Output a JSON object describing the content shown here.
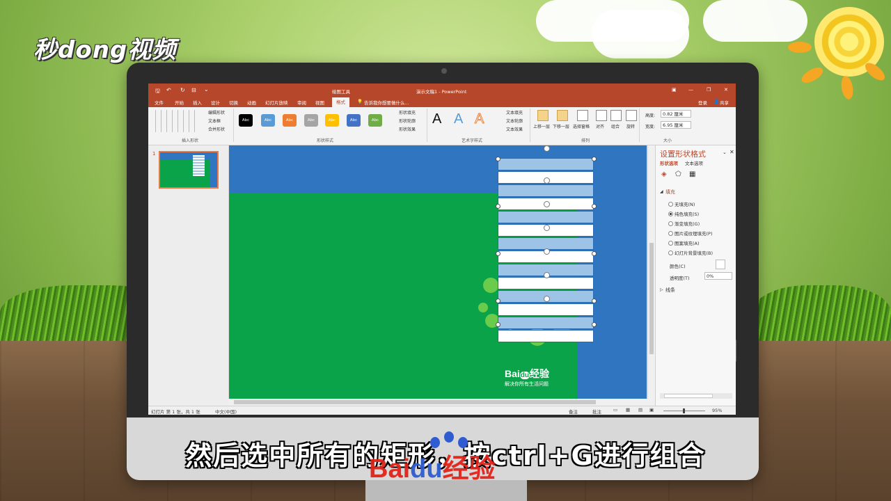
{
  "watermark": {
    "brand": "秒dong视频"
  },
  "window": {
    "drawing_tools": "绘图工具",
    "title": "演示文稿1 - PowerPoint",
    "login": "登录",
    "share": "共享",
    "controls": [
      "▣",
      "—",
      "❐",
      "✕"
    ]
  },
  "quick_access": [
    "🖫",
    "↶",
    "↻",
    "⊟",
    "⌄"
  ],
  "tabs": [
    "文件",
    "开始",
    "插入",
    "设计",
    "切换",
    "动画",
    "幻灯片放映",
    "审阅",
    "视图",
    "格式"
  ],
  "active_tab": "格式",
  "tell_me": "告诉我你想要做什么...",
  "ribbon": {
    "insert_shapes": {
      "label": "插入形状",
      "edit_shape": "编辑形状",
      "text_box": "文本框",
      "merge_shapes": "合并形状"
    },
    "shape_styles": {
      "label": "形状样式",
      "swatch_text": "Abc",
      "swatches": [
        "#000000",
        "#5b9bd5",
        "#ed7d31",
        "#a5a5a5",
        "#ffc000",
        "#4472c4",
        "#70ad47"
      ],
      "fill": "形状填充",
      "outline": "形状轮廓",
      "effects": "形状效果"
    },
    "wordart": {
      "label": "艺术字样式",
      "letters": [
        "A",
        "A",
        "A"
      ],
      "text_fill": "文本填充",
      "text_outline": "文本轮廓",
      "text_effects": "文本效果"
    },
    "arrange": {
      "label": "排列",
      "bring_forward": "上移一层",
      "send_backward": "下移一层",
      "selection_pane": "选择窗格",
      "align": "对齐",
      "group": "组合",
      "rotate": "旋转"
    },
    "size": {
      "label": "大小",
      "height_label": "高度:",
      "height": "0.82 厘米",
      "width_label": "宽度:",
      "width": "6.95 厘米"
    }
  },
  "thumbnails": {
    "number": "1"
  },
  "slide": {
    "baidu_logo": "Bai",
    "baidu_logo2": "du",
    "baidu_cn": "经验",
    "tagline": "解决你所有生活问题"
  },
  "format_pane": {
    "title": "设置形状格式",
    "tab_shape": "形状选项",
    "tab_text": "文本选项",
    "section_fill": "填充",
    "options": [
      "无填充(N)",
      "纯色填充(S)",
      "渐变填充(G)",
      "图片或纹理填充(P)",
      "图案填充(A)",
      "幻灯片背景填充(B)"
    ],
    "selected_option": 1,
    "color_label": "颜色(C)",
    "transparency_label": "透明度(T)",
    "transparency_value": "0%",
    "section_line": "线条"
  },
  "status": {
    "slide_info": "幻灯片 第 1 张，共 1 张",
    "language": "中文(中国)",
    "notes": "备注",
    "comments": "批注",
    "zoom": "95%"
  },
  "subtitle": "然后选中所有的矩形，按ctrl+G进行组合",
  "bottom_brand": {
    "latin": "Bai",
    "latin2": "du",
    "cn": "经验"
  }
}
